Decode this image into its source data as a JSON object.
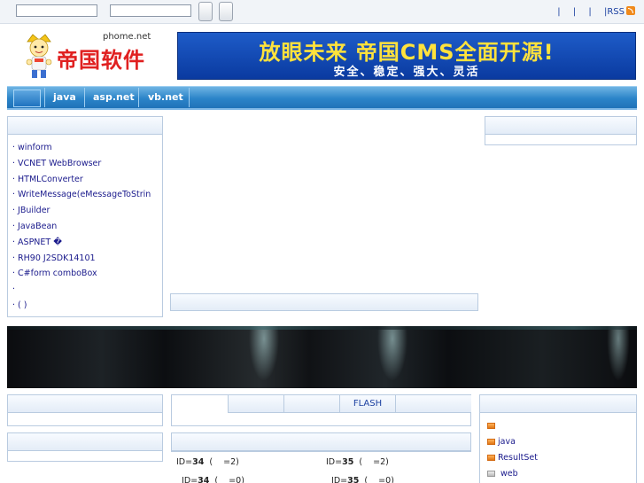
{
  "topbar": {
    "search_input_1": "",
    "search_input_2": "",
    "links": [
      "|",
      "|",
      "|",
      "|RSS"
    ]
  },
  "header": {
    "logo_domain": "phome.net",
    "logo_brand": "帝国软件",
    "banner_line1": "放眼未来 帝国CMS全面开源!",
    "banner_line2": "安全、稳定、强大、灵活"
  },
  "nav": {
    "items": [
      "java",
      "asp.net",
      "vb.net"
    ]
  },
  "left_panel": {
    "items": [
      "·   winform",
      "· VCNET WebBrowser",
      "·   HTMLConverter",
      "· WriteMessage(eMessageToStrin",
      "·   JBuilder",
      "·        JavaBean",
      "·  ASPNET �",
      "·  RH90    J2SDK14101",
      "·  C#form    comboBox",
      "·",
      "·       ( )"
    ]
  },
  "tabs": {
    "items": [
      "",
      "",
      "FLASH",
      ""
    ]
  },
  "list_rows": [
    {
      "pre": "ID=",
      "id": "34",
      "post": "  (    =2)"
    },
    {
      "pre": "ID=",
      "id": "35",
      "post": "  (    =2)"
    },
    {
      "pre": "  ID=",
      "id": "34",
      "post": "  (    =0)"
    },
    {
      "pre": "  ID=",
      "id": "35",
      "post": "  (    =0)"
    }
  ],
  "right_panel": {
    "items": [
      "",
      "java",
      "ResultSet",
      "       web"
    ]
  },
  "colors": {
    "nav": "#2b84c9",
    "banner": "#1e5cc8",
    "banner_text": "#ffe23c",
    "link": "#1a1a8c",
    "rss": "#f08a1c"
  }
}
